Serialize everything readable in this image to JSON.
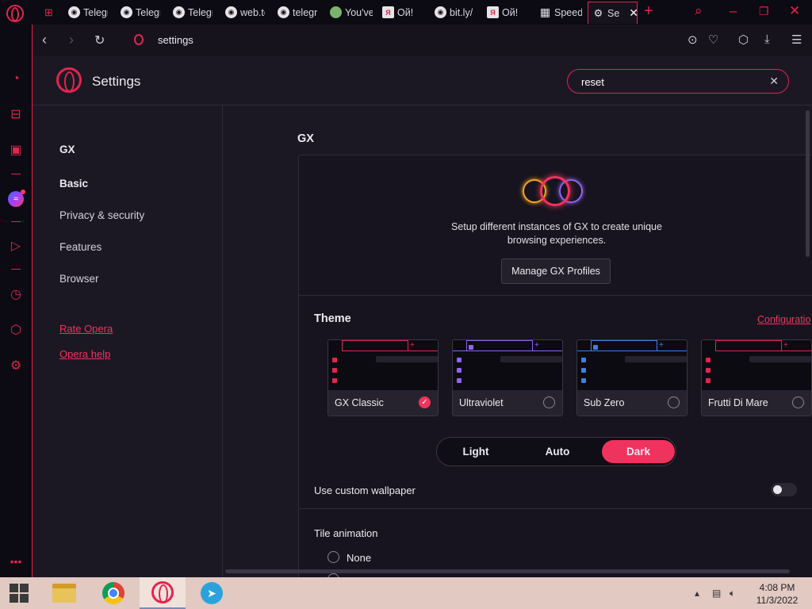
{
  "tabs": [
    {
      "label": "",
      "icon": "gamepad-icon"
    },
    {
      "label": "Telegr",
      "icon": "globe-icon"
    },
    {
      "label": "Telegr",
      "icon": "globe-icon"
    },
    {
      "label": "Telegr",
      "icon": "globe-icon"
    },
    {
      "label": "web.te",
      "icon": "globe-icon"
    },
    {
      "label": "telegr",
      "icon": "globe-icon"
    },
    {
      "label": "You've",
      "icon": "globe-icon"
    },
    {
      "label": "Ой!",
      "icon": "yandex-icon"
    },
    {
      "label": "bit.ly/",
      "icon": "globe-icon"
    },
    {
      "label": "Ой!",
      "icon": "yandex-icon"
    },
    {
      "label": "Speed",
      "icon": "grid-icon"
    },
    {
      "label": "Se",
      "icon": "gear-icon"
    }
  ],
  "address": {
    "url": "settings"
  },
  "settings": {
    "title": "Settings",
    "search_value": "reset",
    "nav": [
      "GX",
      "Basic",
      "Privacy & security",
      "Features",
      "Browser"
    ],
    "links": [
      "Rate Opera",
      "Opera help"
    ],
    "section_title": "GX",
    "profiles_desc_1": "Setup different instances of GX to create unique",
    "profiles_desc_2": "browsing experiences.",
    "manage_button": "Manage GX Profiles",
    "theme_label": "Theme",
    "configure_link": "Configuratio",
    "themes": [
      {
        "name": "GX Classic",
        "accent": "#e0264f",
        "selected": true
      },
      {
        "name": "Ultraviolet",
        "accent": "#8f64f0",
        "selected": false
      },
      {
        "name": "Sub Zero",
        "accent": "#3f7fe8",
        "selected": false
      },
      {
        "name": "Frutti Di Mare",
        "accent": "#e0264f",
        "selected": false
      }
    ],
    "mode_options": [
      "Light",
      "Auto",
      "Dark"
    ],
    "mode_selected": "Dark",
    "wallpaper_label": "Use custom wallpaper",
    "wallpaper_enabled": false,
    "tile_animation_label": "Tile animation",
    "tile_options": [
      "None"
    ]
  },
  "taskbar": {
    "time": "4:08 PM",
    "date": "11/3/2022"
  },
  "colors": {
    "accent": "#e0264f",
    "accent_bright": "#f0335e",
    "bg": "#1b1824"
  }
}
